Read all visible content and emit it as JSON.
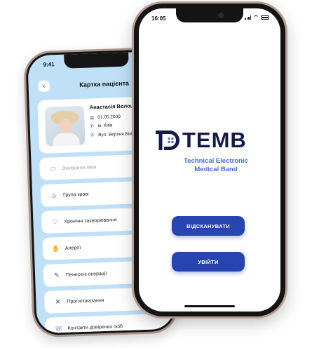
{
  "back_phone": {
    "status_time": "9:41",
    "header": {
      "back_icon": "chevron-left-icon",
      "title": "Картка пацієнта"
    },
    "patient": {
      "name": "Анастасія Волошков",
      "birthdate": "01.05.2000",
      "city": "м. Київ",
      "address": "Вул. Верхня Біківськ"
    },
    "menu": [
      {
        "label": "Вживання ліків",
        "icon": "pill-icon",
        "muted": true
      },
      {
        "label": "Група крові",
        "icon": "blood-drop-icon",
        "muted": false
      },
      {
        "label": "Хронічні захворювання",
        "icon": "heart-icon",
        "muted": false
      },
      {
        "label": "Алергії",
        "icon": "hand-icon",
        "muted": false
      },
      {
        "label": "Пенесені операції",
        "icon": "scalpel-icon",
        "muted": false
      },
      {
        "label": "Протипоказання",
        "icon": "cross-icon",
        "muted": false
      },
      {
        "label": "Контакти довірених осіб",
        "icon": "contacts-icon",
        "muted": false
      }
    ]
  },
  "front_phone": {
    "status_time": "16:05",
    "brand": {
      "name": "TEMB",
      "subtitle_line1": "Technical Electronic",
      "subtitle_line2": "Medical Band",
      "color_primary": "#141a4a",
      "color_accent": "#4a6ad0"
    },
    "buttons": {
      "scan": "ВІДСКАНУВАТИ",
      "login": "УВІЙТИ"
    },
    "button_color": "#2744b0"
  }
}
